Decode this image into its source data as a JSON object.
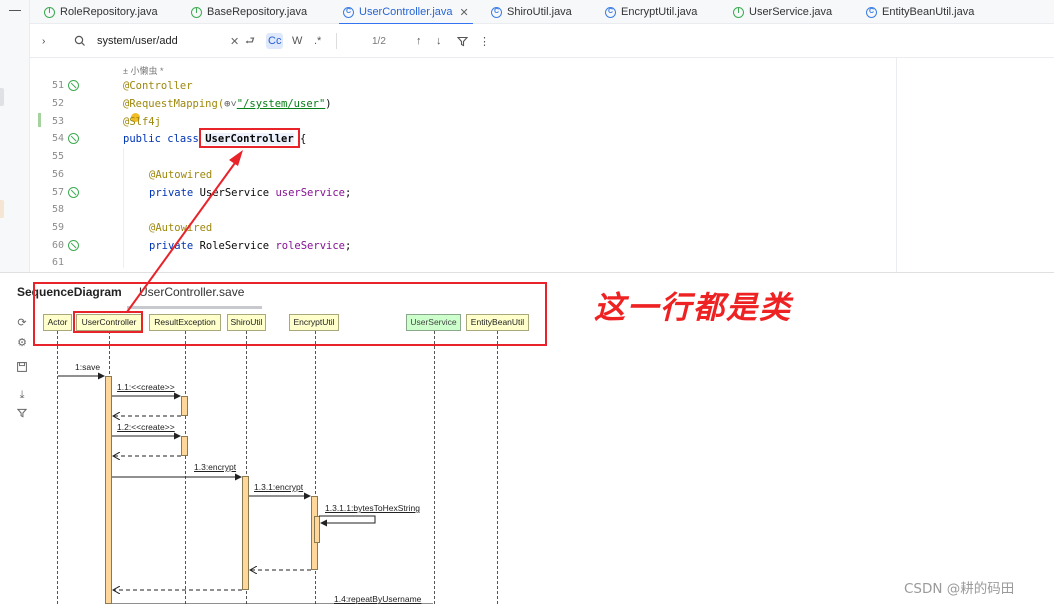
{
  "tabs": [
    {
      "label": "RoleRepository.java",
      "icon": "interface-icon",
      "active": false
    },
    {
      "label": "BaseRepository.java",
      "icon": "interface-icon",
      "active": false
    },
    {
      "label": "UserController.java",
      "icon": "class-icon",
      "active": true
    },
    {
      "label": "ShiroUtil.java",
      "icon": "class-icon",
      "active": false
    },
    {
      "label": "EncryptUtil.java",
      "icon": "class-icon",
      "active": false
    },
    {
      "label": "UserService.java",
      "icon": "interface-icon",
      "active": false
    },
    {
      "label": "EntityBeanUtil.java",
      "icon": "class-icon",
      "active": false
    }
  ],
  "search": {
    "query": "system/user/add",
    "match_count": "1/2",
    "case_toggle": "Cc",
    "word_toggle": "W",
    "regex_toggle": ".*"
  },
  "editor": {
    "author": "± 小懒虫 *",
    "lines": [
      {
        "num": "51",
        "text": "@Controller"
      },
      {
        "num": "52",
        "pre": "@RequestMapping(",
        "str": "\"/system/user\"",
        "post": ")"
      },
      {
        "num": "53",
        "text": "@Slf4j"
      },
      {
        "num": "54",
        "kw": "public class ",
        "cls": "UserController",
        "post": " {"
      },
      {
        "num": "55",
        "text": ""
      },
      {
        "num": "56",
        "text": "@Autowired"
      },
      {
        "num": "57",
        "kw": "private ",
        "type": "UserService ",
        "field": "userService",
        "post": ";"
      },
      {
        "num": "58",
        "text": ""
      },
      {
        "num": "59",
        "text": "@Autowired"
      },
      {
        "num": "60",
        "kw": "private ",
        "type": "RoleService ",
        "field": "roleService",
        "post": ";"
      },
      {
        "num": "61",
        "text": ""
      }
    ]
  },
  "sequence": {
    "tab_main": "SequenceDiagram",
    "tab_file": "UserController.save",
    "participants": [
      "Actor",
      "UserController",
      "ResultException",
      "ShiroUtil",
      "EncryptUtil",
      "UserService",
      "EntityBeanUtil"
    ],
    "messages": [
      "1:save",
      "1.1:<<create>>",
      "1.2:<<create>>",
      "1.3:encrypt",
      "1.3.1:encrypt",
      "1.3.1.1:bytesToHexString",
      "1.4:repeatByUsername"
    ]
  },
  "annotation": "这一行都是类",
  "watermark": "CSDN @耕的码田",
  "colors": {
    "highlight": "#e8232a",
    "participant_bg": "#ffffcc",
    "activation_bg": "#ffd79a",
    "active_tab": "#3574f0"
  }
}
